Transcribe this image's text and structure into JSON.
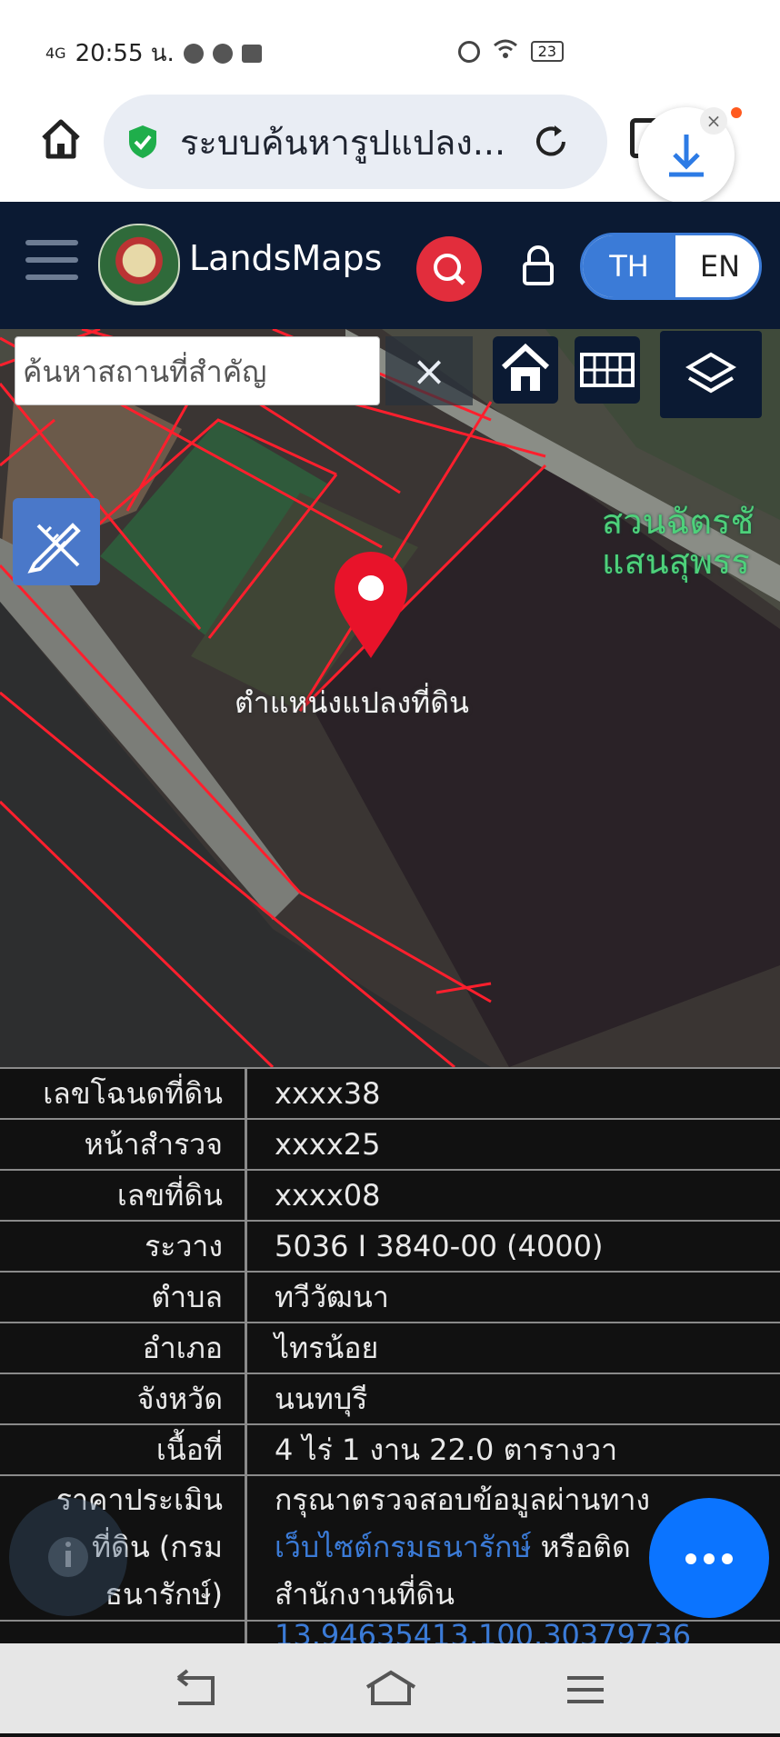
{
  "status_bar": {
    "network": "4G",
    "time": "20:55 น.",
    "battery": "23",
    "icons": [
      "messenger-icon",
      "line-icon",
      "mail-icon",
      "alarm-icon",
      "wifi-icon",
      "battery-icon"
    ]
  },
  "browser": {
    "url_text": "ระบบค้นหารูปแปลง...",
    "icons": [
      "home-icon",
      "shield-check-icon",
      "reload-icon",
      "tabs-icon",
      "download-icon",
      "close-icon"
    ],
    "dl_close": "×"
  },
  "header": {
    "brand": "LandsMaps",
    "lang_th": "TH",
    "lang_en": "EN",
    "colors": {
      "nav_bg": "#0b1a33",
      "accent": "#3b7bd7",
      "search_red": "#e22d3c"
    }
  },
  "map": {
    "search_placeholder": "ค้นหาสถานที่สำคัญ",
    "clear_label": "×",
    "pin_label": "ตำแหน่งแปลงที่ดิน",
    "place_label_line1": "สวนฉัตรชั",
    "place_label_line2": "แสนสุพรร"
  },
  "parcel": {
    "rows": [
      {
        "label": "เลขโฉนดที่ดิน",
        "value": "xxxx38"
      },
      {
        "label": "หน้าสำรวจ",
        "value": "xxxx25"
      },
      {
        "label": "เลขที่ดิน",
        "value": "xxxx08"
      },
      {
        "label": "ระวาง",
        "value": "5036 I 3840-00 (4000)"
      },
      {
        "label": "ตำบล",
        "value": "ทวีวัฒนา"
      },
      {
        "label": "อำเภอ",
        "value": "ไทรน้อย"
      },
      {
        "label": "จังหวัด",
        "value": "นนทบุรี"
      },
      {
        "label": "เนื้อที่",
        "value": "4 ไร่ 1 งาน 22.0 ตารางวา"
      }
    ],
    "price_label_1": "ราคาประเมิน",
    "price_label_2": "ที่ดิน (กรม",
    "price_label_3": "ธนารักษ์)",
    "price_value_1": "กรุณาตรวจสอบข้อมูลผ่านทาง",
    "price_link": "เว็บไซต์กรมธนารักษ์",
    "price_value_2": " หรือติด",
    "price_value_3": "สำนักงานที่ดิน",
    "coords_partial": "13.94635413,100.30379736"
  }
}
